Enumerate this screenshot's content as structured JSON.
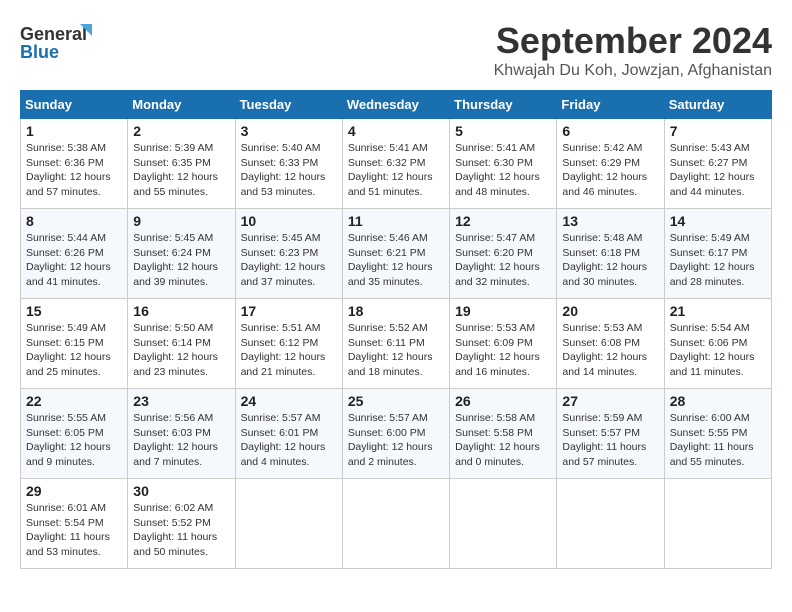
{
  "logo": {
    "line1": "General",
    "line2": "Blue"
  },
  "title": "September 2024",
  "location": "Khwajah Du Koh, Jowzjan, Afghanistan",
  "days_of_week": [
    "Sunday",
    "Monday",
    "Tuesday",
    "Wednesday",
    "Thursday",
    "Friday",
    "Saturday"
  ],
  "weeks": [
    [
      {
        "day": "1",
        "info": "Sunrise: 5:38 AM\nSunset: 6:36 PM\nDaylight: 12 hours\nand 57 minutes."
      },
      {
        "day": "2",
        "info": "Sunrise: 5:39 AM\nSunset: 6:35 PM\nDaylight: 12 hours\nand 55 minutes."
      },
      {
        "day": "3",
        "info": "Sunrise: 5:40 AM\nSunset: 6:33 PM\nDaylight: 12 hours\nand 53 minutes."
      },
      {
        "day": "4",
        "info": "Sunrise: 5:41 AM\nSunset: 6:32 PM\nDaylight: 12 hours\nand 51 minutes."
      },
      {
        "day": "5",
        "info": "Sunrise: 5:41 AM\nSunset: 6:30 PM\nDaylight: 12 hours\nand 48 minutes."
      },
      {
        "day": "6",
        "info": "Sunrise: 5:42 AM\nSunset: 6:29 PM\nDaylight: 12 hours\nand 46 minutes."
      },
      {
        "day": "7",
        "info": "Sunrise: 5:43 AM\nSunset: 6:27 PM\nDaylight: 12 hours\nand 44 minutes."
      }
    ],
    [
      {
        "day": "8",
        "info": "Sunrise: 5:44 AM\nSunset: 6:26 PM\nDaylight: 12 hours\nand 41 minutes."
      },
      {
        "day": "9",
        "info": "Sunrise: 5:45 AM\nSunset: 6:24 PM\nDaylight: 12 hours\nand 39 minutes."
      },
      {
        "day": "10",
        "info": "Sunrise: 5:45 AM\nSunset: 6:23 PM\nDaylight: 12 hours\nand 37 minutes."
      },
      {
        "day": "11",
        "info": "Sunrise: 5:46 AM\nSunset: 6:21 PM\nDaylight: 12 hours\nand 35 minutes."
      },
      {
        "day": "12",
        "info": "Sunrise: 5:47 AM\nSunset: 6:20 PM\nDaylight: 12 hours\nand 32 minutes."
      },
      {
        "day": "13",
        "info": "Sunrise: 5:48 AM\nSunset: 6:18 PM\nDaylight: 12 hours\nand 30 minutes."
      },
      {
        "day": "14",
        "info": "Sunrise: 5:49 AM\nSunset: 6:17 PM\nDaylight: 12 hours\nand 28 minutes."
      }
    ],
    [
      {
        "day": "15",
        "info": "Sunrise: 5:49 AM\nSunset: 6:15 PM\nDaylight: 12 hours\nand 25 minutes."
      },
      {
        "day": "16",
        "info": "Sunrise: 5:50 AM\nSunset: 6:14 PM\nDaylight: 12 hours\nand 23 minutes."
      },
      {
        "day": "17",
        "info": "Sunrise: 5:51 AM\nSunset: 6:12 PM\nDaylight: 12 hours\nand 21 minutes."
      },
      {
        "day": "18",
        "info": "Sunrise: 5:52 AM\nSunset: 6:11 PM\nDaylight: 12 hours\nand 18 minutes."
      },
      {
        "day": "19",
        "info": "Sunrise: 5:53 AM\nSunset: 6:09 PM\nDaylight: 12 hours\nand 16 minutes."
      },
      {
        "day": "20",
        "info": "Sunrise: 5:53 AM\nSunset: 6:08 PM\nDaylight: 12 hours\nand 14 minutes."
      },
      {
        "day": "21",
        "info": "Sunrise: 5:54 AM\nSunset: 6:06 PM\nDaylight: 12 hours\nand 11 minutes."
      }
    ],
    [
      {
        "day": "22",
        "info": "Sunrise: 5:55 AM\nSunset: 6:05 PM\nDaylight: 12 hours\nand 9 minutes."
      },
      {
        "day": "23",
        "info": "Sunrise: 5:56 AM\nSunset: 6:03 PM\nDaylight: 12 hours\nand 7 minutes."
      },
      {
        "day": "24",
        "info": "Sunrise: 5:57 AM\nSunset: 6:01 PM\nDaylight: 12 hours\nand 4 minutes."
      },
      {
        "day": "25",
        "info": "Sunrise: 5:57 AM\nSunset: 6:00 PM\nDaylight: 12 hours\nand 2 minutes."
      },
      {
        "day": "26",
        "info": "Sunrise: 5:58 AM\nSunset: 5:58 PM\nDaylight: 12 hours\nand 0 minutes."
      },
      {
        "day": "27",
        "info": "Sunrise: 5:59 AM\nSunset: 5:57 PM\nDaylight: 11 hours\nand 57 minutes."
      },
      {
        "day": "28",
        "info": "Sunrise: 6:00 AM\nSunset: 5:55 PM\nDaylight: 11 hours\nand 55 minutes."
      }
    ],
    [
      {
        "day": "29",
        "info": "Sunrise: 6:01 AM\nSunset: 5:54 PM\nDaylight: 11 hours\nand 53 minutes."
      },
      {
        "day": "30",
        "info": "Sunrise: 6:02 AM\nSunset: 5:52 PM\nDaylight: 11 hours\nand 50 minutes."
      },
      {
        "day": "",
        "info": ""
      },
      {
        "day": "",
        "info": ""
      },
      {
        "day": "",
        "info": ""
      },
      {
        "day": "",
        "info": ""
      },
      {
        "day": "",
        "info": ""
      }
    ]
  ]
}
